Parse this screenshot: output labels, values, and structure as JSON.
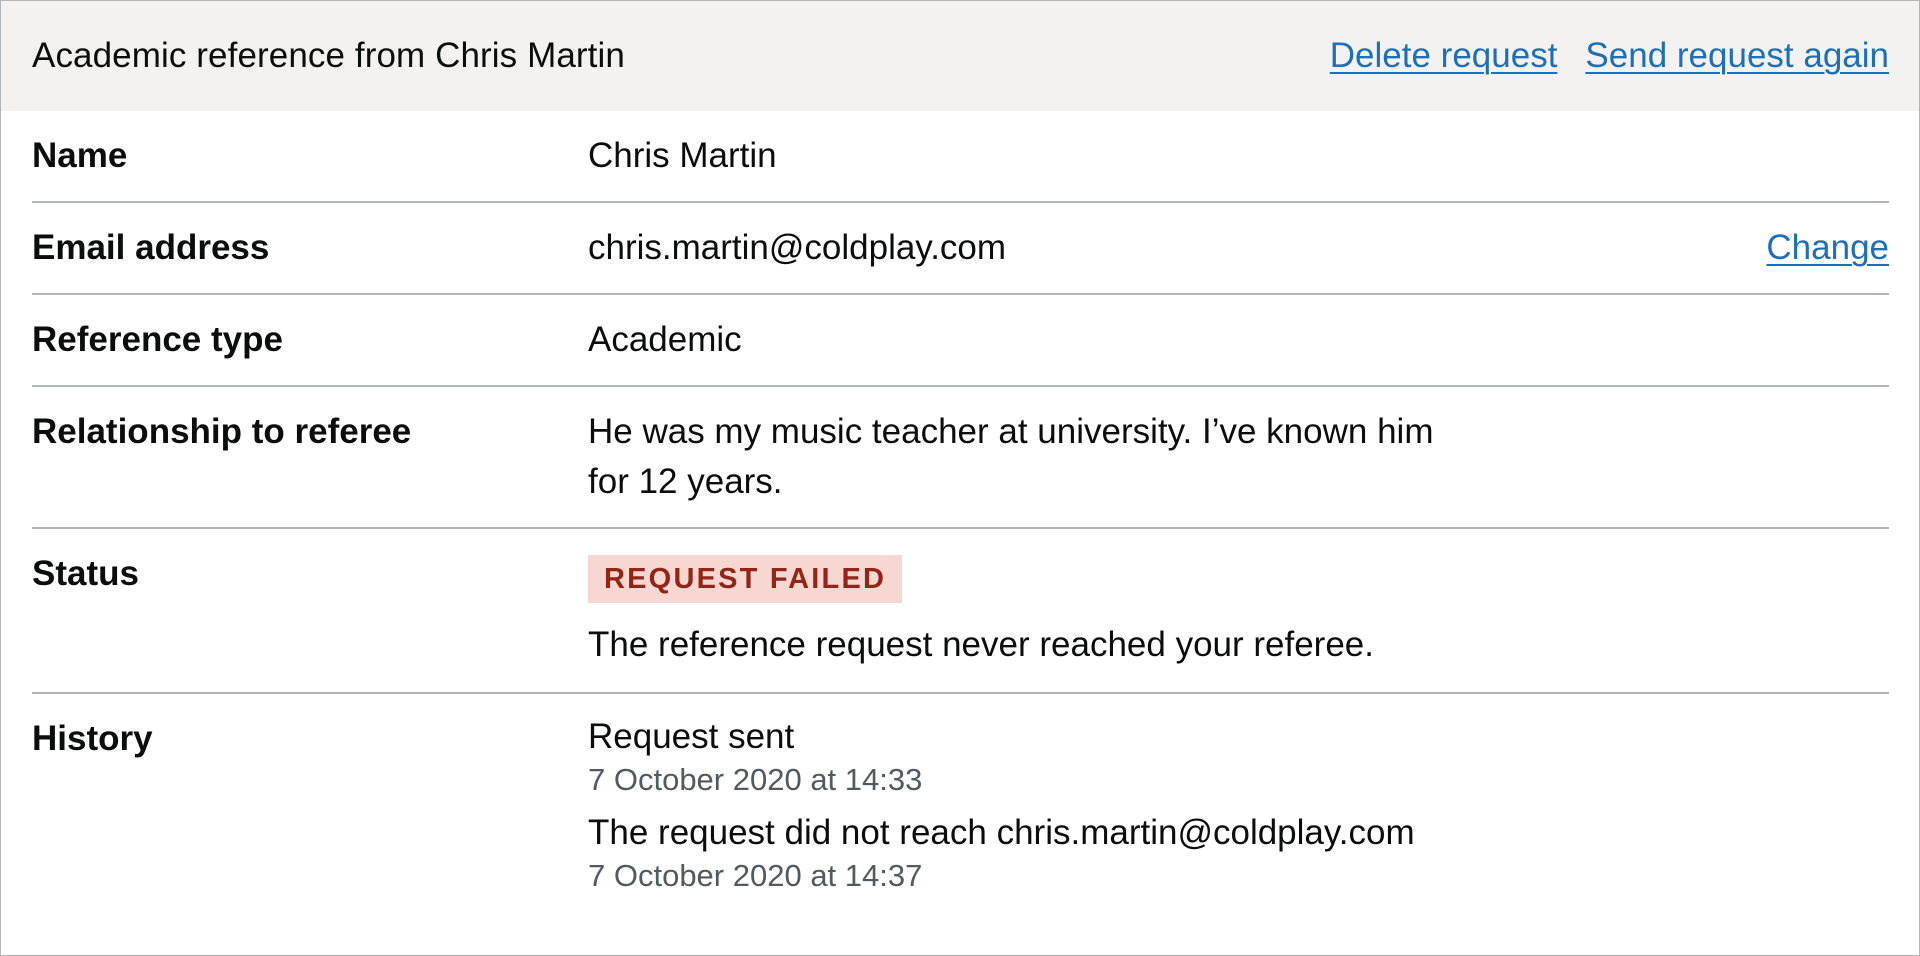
{
  "card": {
    "title": "Academic reference from Chris Martin",
    "actions": {
      "delete": "Delete request",
      "resend": "Send request again"
    }
  },
  "rows": {
    "name": {
      "key": "Name",
      "value": "Chris Martin"
    },
    "email": {
      "key": "Email address",
      "value": "chris.martin@coldplay.com",
      "action": "Change"
    },
    "type": {
      "key": "Reference type",
      "value": "Academic"
    },
    "relationship": {
      "key": "Relationship to referee",
      "value_line1": "He was my music teacher at university. I’ve known him",
      "value_line2": "for 12 years."
    },
    "status": {
      "key": "Status",
      "tag": "REQUEST FAILED",
      "message": "The reference request never reached your referee."
    },
    "history": {
      "key": "History",
      "events": [
        {
          "text": "Request sent",
          "time": "7 October 2020 at 14:33"
        },
        {
          "text": "The request did not reach chris.martin@coldplay.com",
          "time": "7 October 2020 at 14:37"
        }
      ]
    }
  },
  "colors": {
    "link": "#1d70b8",
    "header_bg": "#f3f2f1",
    "border": "#b1b4b6",
    "tag_bg": "#f6d7d2",
    "tag_text": "#942514",
    "secondary_text": "#505a5f"
  }
}
